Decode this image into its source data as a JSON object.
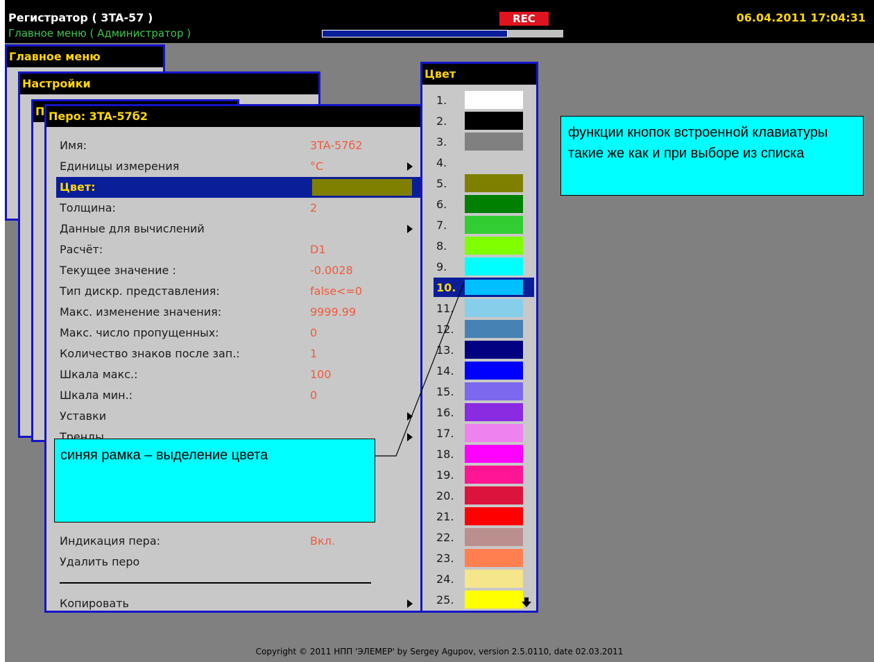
{
  "header": {
    "title": "Регистратор ( 3TA-57 )",
    "subtitle": "Главное меню ( Администратор )",
    "rec_label": "REC",
    "progress_fraction": 0.77,
    "datetime": "06.04.2011   17:04:31"
  },
  "windows": {
    "main_menu": "Главное меню",
    "settings": "Настройки",
    "hidden_letter": "П",
    "pen": "Перо: 3TA-57б2"
  },
  "pen_rows": [
    {
      "label": "Имя:",
      "value": "3TA-57б2"
    },
    {
      "label": "Единицы измерения",
      "value": "°C",
      "arrow": true
    },
    {
      "label": "Цвет:",
      "selected": true,
      "swatch": "#808000"
    },
    {
      "label": "Толщина:",
      "value": "2"
    },
    {
      "label": "Данные для вычислений",
      "arrow": true
    },
    {
      "label": "Расчёт:",
      "value": "D1"
    },
    {
      "label": "Текущее значение :",
      "value": "-0.0028"
    },
    {
      "label": "Тип дискр. представления:",
      "value": "false<=0"
    },
    {
      "label": "Макс. изменение значения:",
      "value": "9999.99"
    },
    {
      "label": "Макс. число пропущенных:",
      "value": "0"
    },
    {
      "label": "Количество знаков после зап.:",
      "value": "1"
    },
    {
      "label": "Шкала макс.:",
      "value": "100"
    },
    {
      "label": "Шкала мин.:",
      "value": "0"
    },
    {
      "label": "Уставки",
      "arrow": true
    },
    {
      "label": "Тренды",
      "arrow": true
    },
    {
      "label": ""
    },
    {
      "label": ""
    },
    {
      "label": ""
    },
    {
      "label": ""
    },
    {
      "label": "Индикация пера:",
      "value": "Вкл."
    },
    {
      "label": "Удалить перо"
    },
    {
      "separator": true
    },
    {
      "label": "Копировать",
      "arrow": true
    }
  ],
  "color_window": {
    "title": "Цвет",
    "selected_index": 10,
    "colors": [
      {
        "num": "1.",
        "hex": "#ffffff"
      },
      {
        "num": "2.",
        "hex": "#000000"
      },
      {
        "num": "3.",
        "hex": "#808080"
      },
      {
        "num": "4.",
        "hex": "#c8c8c8"
      },
      {
        "num": "5.",
        "hex": "#808000"
      },
      {
        "num": "6.",
        "hex": "#008000"
      },
      {
        "num": "7.",
        "hex": "#32cd32"
      },
      {
        "num": "8.",
        "hex": "#7fff00"
      },
      {
        "num": "9.",
        "hex": "#00ffff"
      },
      {
        "num": "10.",
        "hex": "#00bfff"
      },
      {
        "num": "11.",
        "hex": "#87ceeb"
      },
      {
        "num": "12.",
        "hex": "#4682b4"
      },
      {
        "num": "13.",
        "hex": "#000080"
      },
      {
        "num": "14.",
        "hex": "#0000ff"
      },
      {
        "num": "15.",
        "hex": "#7b68ee"
      },
      {
        "num": "16.",
        "hex": "#8a2be2"
      },
      {
        "num": "17.",
        "hex": "#ee82ee"
      },
      {
        "num": "18.",
        "hex": "#ff00ff"
      },
      {
        "num": "19.",
        "hex": "#ff1493"
      },
      {
        "num": "20.",
        "hex": "#dc143c"
      },
      {
        "num": "21.",
        "hex": "#ff0000"
      },
      {
        "num": "22.",
        "hex": "#bc8f8f"
      },
      {
        "num": "23.",
        "hex": "#ff7f50"
      },
      {
        "num": "24.",
        "hex": "#f5e68c"
      },
      {
        "num": "25.",
        "hex": "#ffff00"
      }
    ]
  },
  "callouts": {
    "top": "функции кнопок встроенной клавиатуры такие же как и при выборе из списка",
    "bottom": "синяя рамка – выделение цвета"
  },
  "footer": {
    "copyright": "Copyright © 2011 НПП 'ЭЛЕМЕР' by Sergey Agupov, version 2.5.0110, date 02.03.2011"
  },
  "colors": {
    "accent_blue": "#0a1e9a",
    "frame_blue": "#1414c8",
    "title_yellow": "#ffd700",
    "value_red": "#f05a3c",
    "callout_cyan": "#00ffff"
  }
}
